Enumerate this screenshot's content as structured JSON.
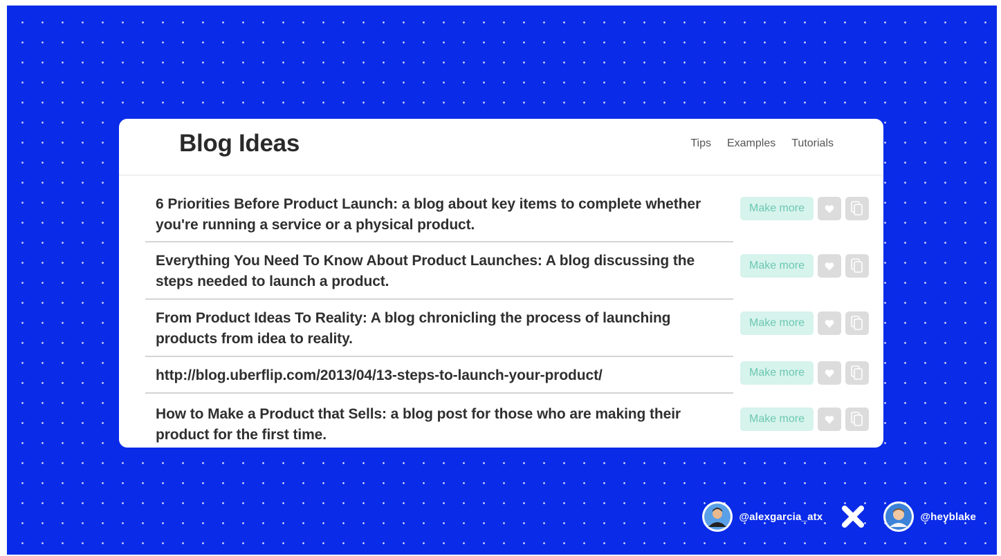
{
  "card": {
    "title": "Blog Ideas",
    "nav": [
      "Tips",
      "Examples",
      "Tutorials"
    ]
  },
  "ideas": [
    {
      "text": "6 Priorities Before Product Launch: a blog about key items to complete whether you're running a service or a physical product.",
      "action": "Make more"
    },
    {
      "text": "Everything You Need To Know About Product Launches: A blog discussing the steps needed to launch a product.",
      "action": "Make more"
    },
    {
      "text": "From Product Ideas To Reality: A blog chronicling the process of launching products from idea to reality.",
      "action": "Make more"
    },
    {
      "text": "http://blog.uberflip.com/2013/04/13-steps-to-launch-your-product/",
      "action": "Make more"
    },
    {
      "text": "How to Make a Product that Sells: a blog post for those who are making their product for the first time.",
      "action": "Make more"
    }
  ],
  "footer": {
    "handle_left": "@alexgarcia_atx",
    "handle_right": "@heyblake"
  },
  "colors": {
    "background": "#0a2be8",
    "make_more_bg": "#d6f3ec",
    "make_more_text": "#6cc8b2",
    "icon_btn_bg": "#dcdcdc"
  }
}
